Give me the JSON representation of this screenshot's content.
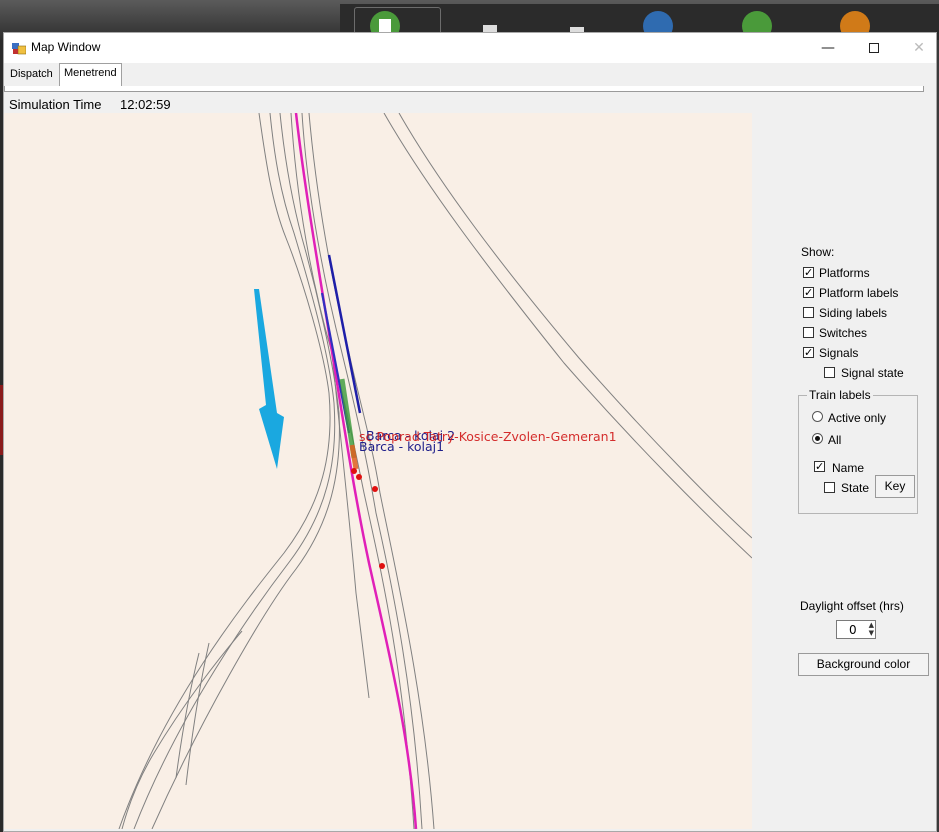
{
  "window": {
    "title": "Map Window"
  },
  "tabs": [
    {
      "label": "Dispatch"
    },
    {
      "label": "Menetrend"
    }
  ],
  "status": {
    "sim_time_label": "Simulation Time",
    "sim_time_value": "12:02:59"
  },
  "map": {
    "platform_labels": [
      "Barca - kolaj 2",
      "Barca - kolaj1"
    ],
    "train_label": "sc Poprad Tatry-Kosice-Zvolen-Gemeran1",
    "colors": {
      "background": "#f9efe6",
      "track": "#808080",
      "route": "#e020b8",
      "platform": "#1e1ea8",
      "signal": "#e01010",
      "train": "#2a8a2a"
    }
  },
  "show": {
    "heading": "Show:",
    "options": [
      {
        "label": "Platforms",
        "checked": true
      },
      {
        "label": "Platform labels",
        "checked": true
      },
      {
        "label": "Siding labels",
        "checked": false
      },
      {
        "label": "Switches",
        "checked": false
      },
      {
        "label": "Signals",
        "checked": true
      },
      {
        "label": "Signal state",
        "checked": false
      }
    ]
  },
  "train_labels": {
    "group_title": "Train labels",
    "active_only": "Active only",
    "all": "All",
    "name": "Name",
    "state": "State",
    "key_button": "Key"
  },
  "daylight": {
    "label": "Daylight offset (hrs)",
    "value": "0"
  },
  "background_button": "Background color"
}
